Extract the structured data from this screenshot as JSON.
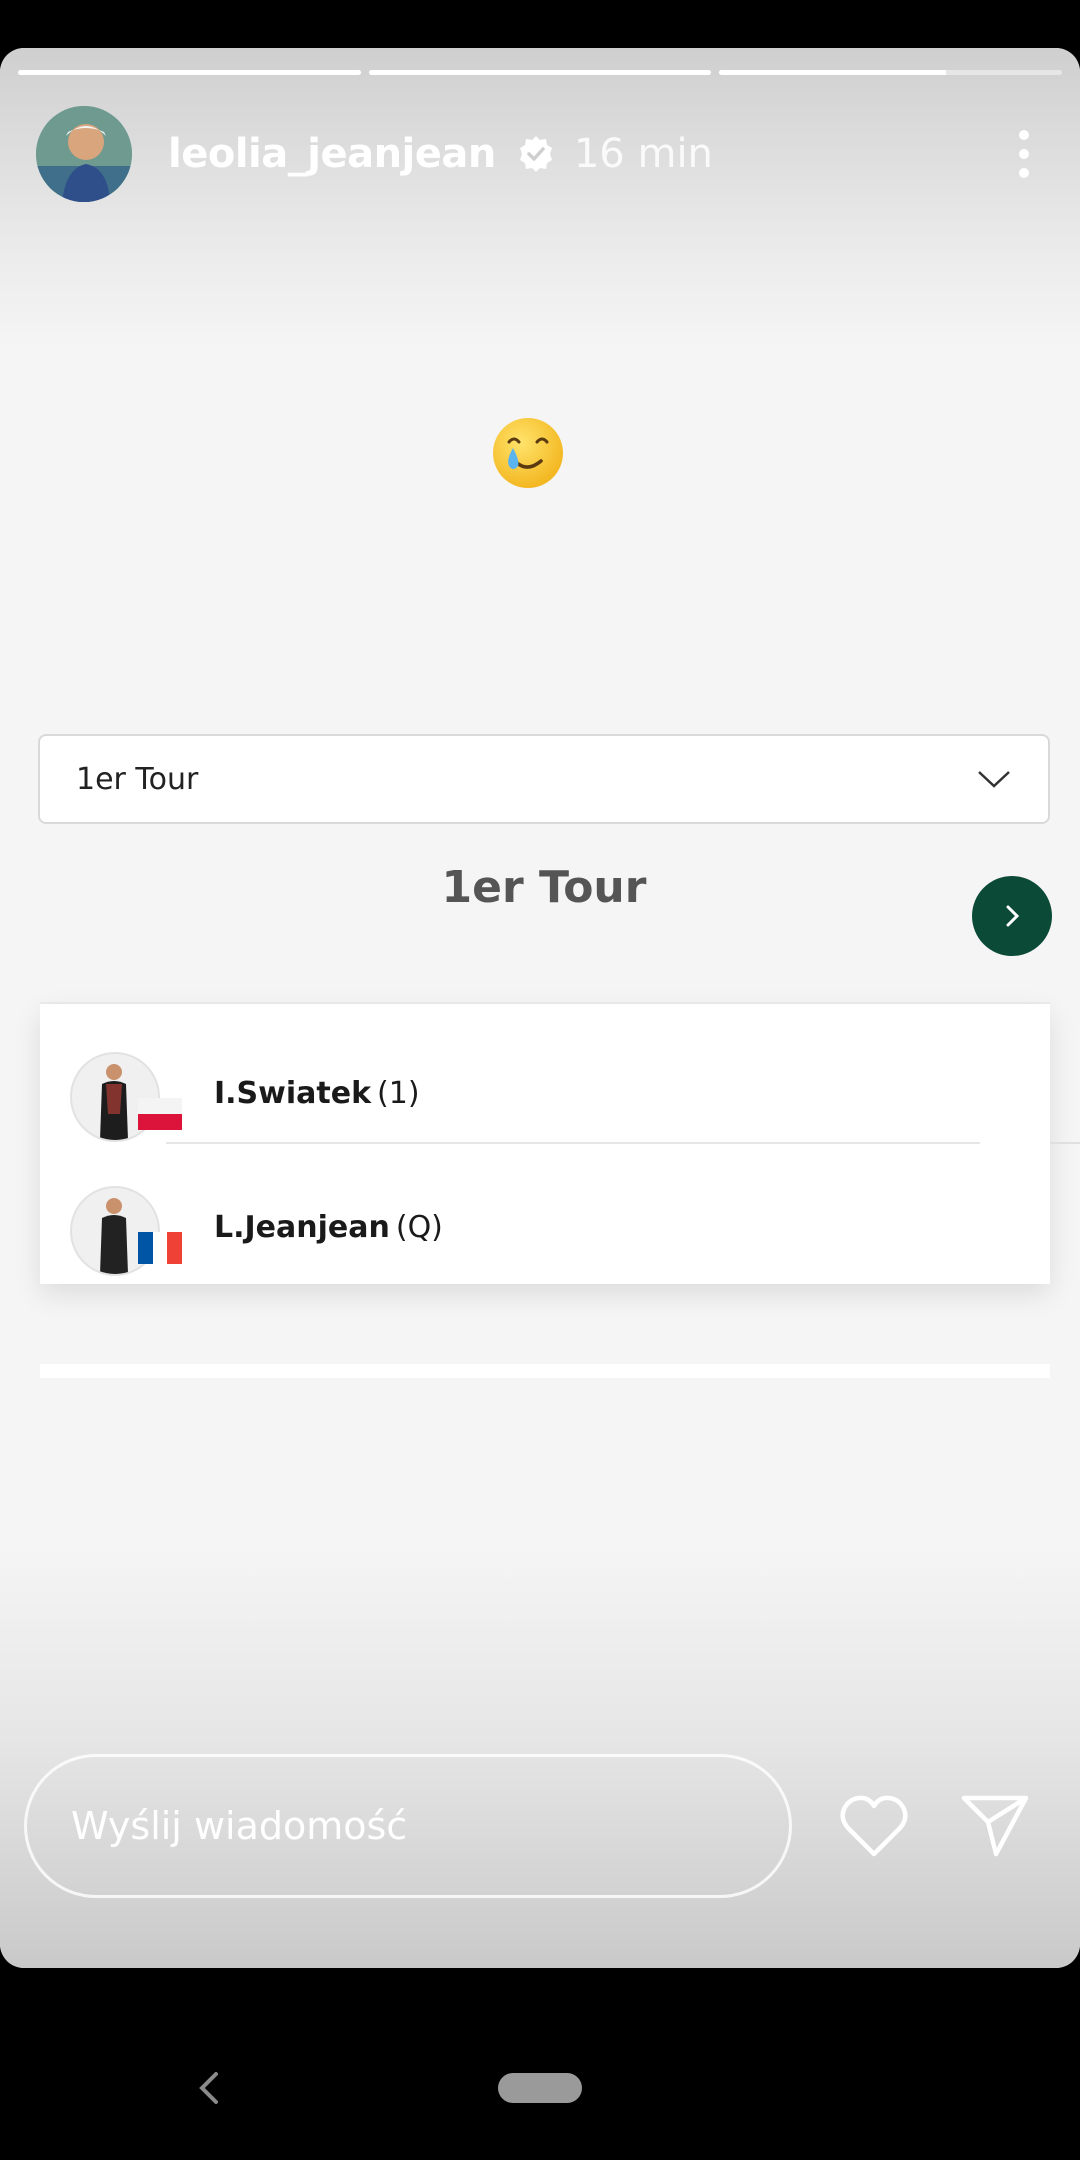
{
  "story": {
    "progress": [
      1.0,
      1.0,
      0.66
    ],
    "username": "leolia_jeanjean",
    "time": "16 min",
    "emoji": "smiling face with tear"
  },
  "embedded": {
    "dropdown_label": "1er Tour",
    "round_title": "1er Tour",
    "players": [
      {
        "name": "I.Swiatek",
        "seed": "(1)",
        "flag": "Poland"
      },
      {
        "name": "L.Jeanjean",
        "seed": "(Q)",
        "flag": "France"
      }
    ]
  },
  "reply": {
    "placeholder": "Wyślij wiadomość"
  },
  "colors": {
    "accent_green": "#0b4a36",
    "poland_red": "#dc143c",
    "france_blue": "#0055a4",
    "france_red": "#ef4135"
  }
}
